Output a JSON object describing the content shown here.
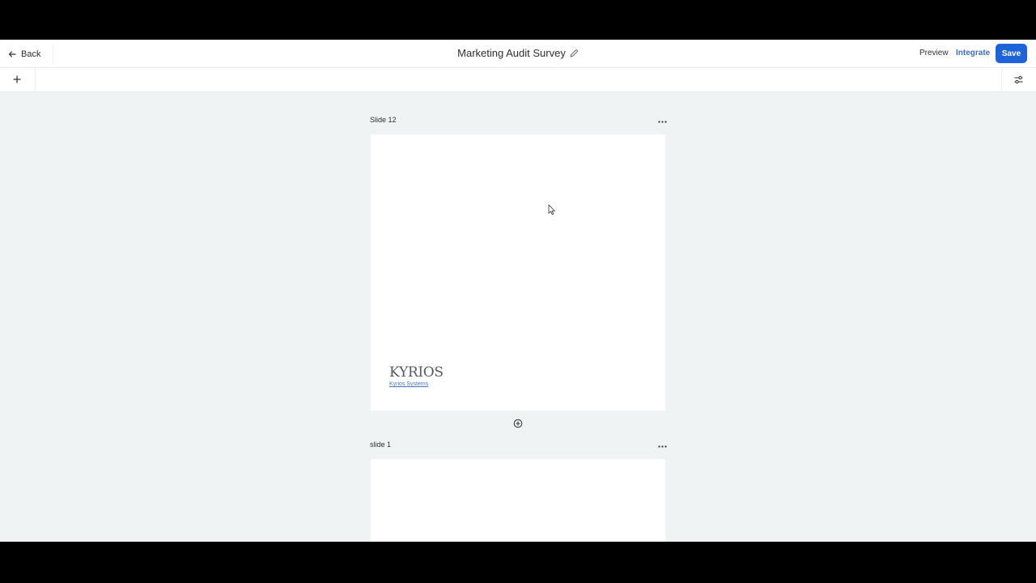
{
  "header": {
    "back_label": "Back",
    "title": "Marketing Audit Survey",
    "preview_label": "Preview",
    "integrate_label": "Integrate",
    "save_label": "Save"
  },
  "slides": [
    {
      "label": "Slide 12",
      "logo_text": "KYRIOS",
      "logo_link": "Kyrios Systems"
    },
    {
      "label": "slide 1"
    }
  ],
  "icons": {
    "back": "arrow-left-icon",
    "edit": "pencil-icon",
    "add": "plus-icon",
    "settings": "sliders-icon",
    "more": "ellipsis-icon",
    "add_slide": "plus-circle-icon"
  },
  "colors": {
    "accent": "#1f63d8",
    "integrate": "#3b6fb8",
    "canvas": "#eff3f4",
    "link": "#4a79b6"
  }
}
